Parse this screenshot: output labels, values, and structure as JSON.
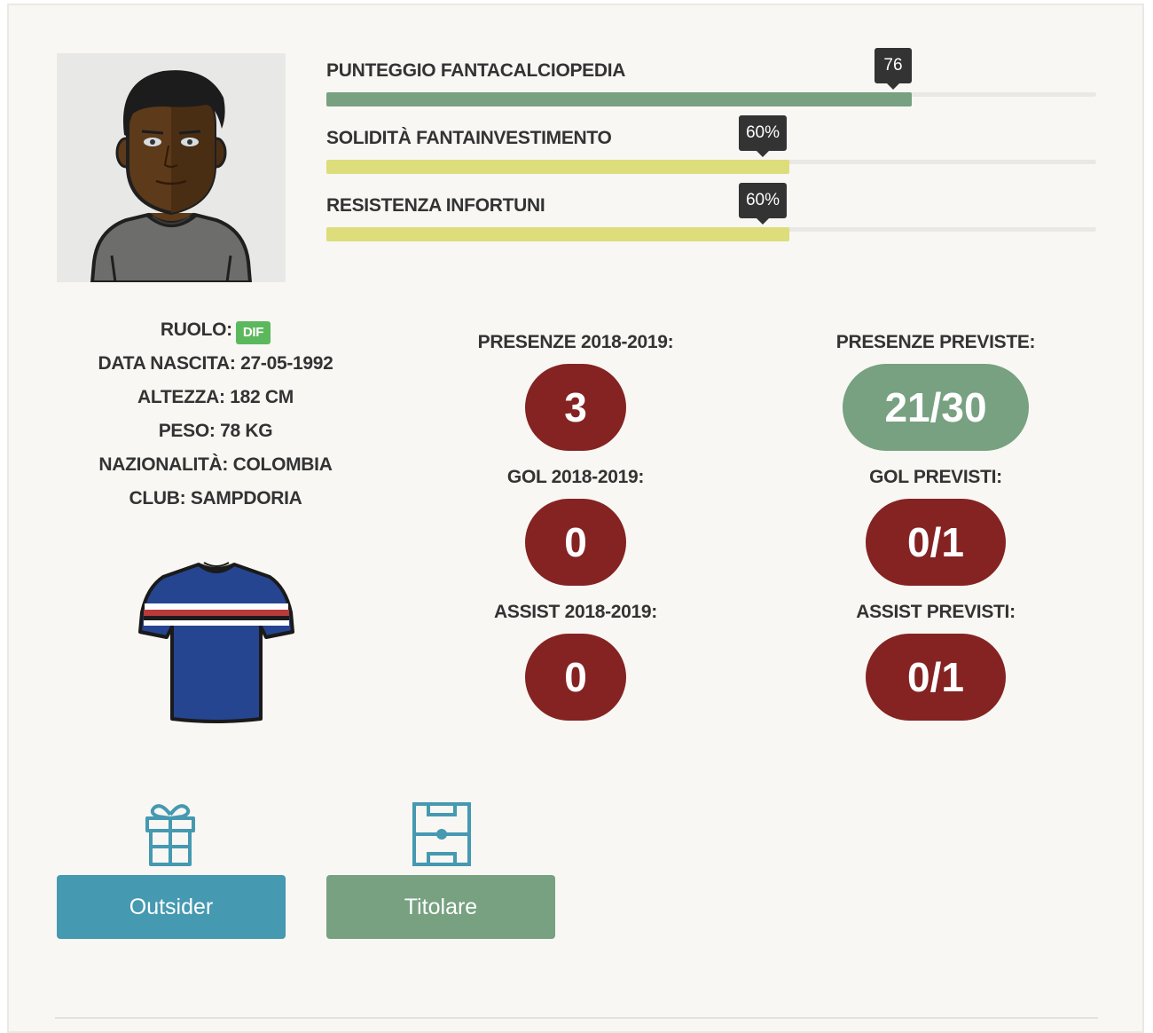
{
  "colors": {
    "card_background": "#f8f7f3",
    "score_bar": "#77a181",
    "yellow_bar": "#dddd7b",
    "stat_red": "#842322",
    "stat_green": "#77a181",
    "role_badge": "#5cb85c",
    "outsider_button": "#4599b1",
    "titolare_button": "#77a181",
    "icon_teal": "#4599b1"
  },
  "bars": [
    {
      "label": "PUNTEGGIO FANTACALCIOPEDIA",
      "value": 76,
      "tip": "76",
      "fill_fraction": 0.76,
      "color": "#77a181"
    },
    {
      "label": "SOLIDITÀ FANTAINVESTIMENTO",
      "value": 60,
      "tip": "60%",
      "fill_fraction": 0.6,
      "color": "#dddd7b"
    },
    {
      "label": "RESISTENZA INFORTUNI",
      "value": 60,
      "tip": "60%",
      "fill_fraction": 0.6,
      "color": "#dddd7b"
    }
  ],
  "info": {
    "role_label": "RUOLO:",
    "role_badge": "DIF",
    "birth": "DATA NASCITA: 27-05-1992",
    "height": "ALTEZZA: 182 CM",
    "weight": "PESO: 78 KG",
    "nationality": "NAZIONALITÀ: COLOMBIA",
    "club": "CLUB: SAMPDORIA"
  },
  "stats": {
    "presenze": {
      "label": "PRESENZE 2018-2019:",
      "value": "3"
    },
    "presenze_previste": {
      "label": "PRESENZE PREVISTE:",
      "value": "21/30"
    },
    "gol": {
      "label": "GOL 2018-2019:",
      "value": "0"
    },
    "gol_previsti": {
      "label": "GOL PREVISTI:",
      "value": "0/1"
    },
    "assist": {
      "label": "ASSIST 2018-2019:",
      "value": "0"
    },
    "assist_previsti": {
      "label": "ASSIST PREVISTI:",
      "value": "0/1"
    }
  },
  "buttons": {
    "outsider": {
      "label": "Outsider",
      "icon": "gift-icon"
    },
    "titolare": {
      "label": "Titolare",
      "icon": "football-pitch-icon"
    }
  }
}
